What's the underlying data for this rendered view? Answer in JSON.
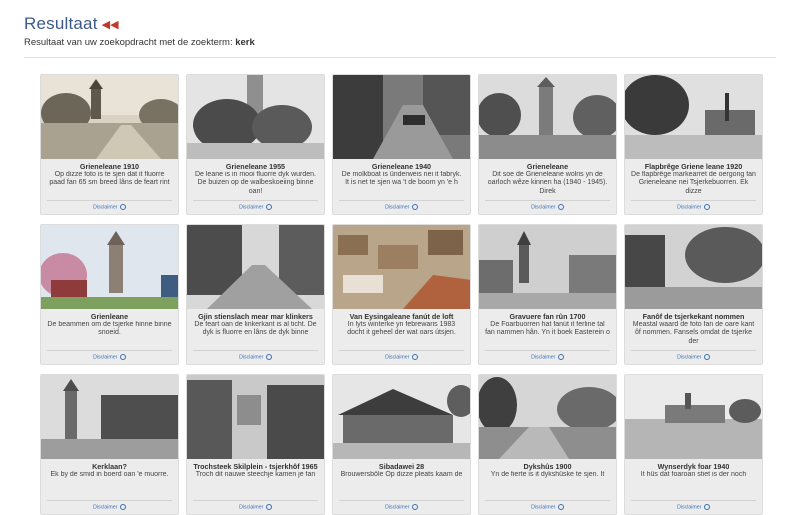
{
  "header": {
    "title": "Resultaat",
    "subtitle_prefix": "Resultaat van uw zoekopdracht met de zoekterm:",
    "search_term": "kerk"
  },
  "cards": [
    {
      "title": "Grieneleane 1910",
      "description": "Op dizze foto is te sjen dat it fluorre paad fan 65 sm breed lâns de feart rint",
      "disclaimer": "Disclaimer"
    },
    {
      "title": "Grieneleane 1955",
      "description": "De leane is in mooi fluorre dyk wurden. De buizen op de walbeskoeiing binne oan!",
      "disclaimer": "Disclaimer"
    },
    {
      "title": "Grieneleane 1940",
      "description": "De molkboat is ûnderweis nei it fabryk. It is net te sjen wa 't de boom yn 'e h",
      "disclaimer": "Disclaimer"
    },
    {
      "title": "Grieneleane",
      "description": "Dit soe de Grieneleane wolris yn de oarloch wêze kinnen ha (1940 - 1945). Direk",
      "disclaimer": "Disclaimer"
    },
    {
      "title": "Flapbrêge Griene leane 1920",
      "description": "De flapbrêge markearret de oergong fan Grieneleane nei Tsjerkebuorren. Ek dizze",
      "disclaimer": "Disclaimer"
    },
    {
      "title": "Grienleane",
      "description": "De beammen om de tsjerke hinne binne snoeid.",
      "disclaimer": "Disclaimer"
    },
    {
      "title": "Gjin stienslach mear mar klinkers",
      "description": "De feart oan de linkerkant is al ticht. De dyk is fluorre en lâns de dyk binne",
      "disclaimer": "Disclaimer"
    },
    {
      "title": "Van Eysingaleane fanút de loft",
      "description": "In lyts winterke yn febrewaris 1983 docht it geheel der wat oars útsjen.",
      "disclaimer": "Disclaimer"
    },
    {
      "title": "Gravuere fan rûn 1700",
      "description": "De Foarbuorren hat fanút it ferline tal fan nammen hân. Yn it boek Easterein o",
      "disclaimer": "Disclaimer"
    },
    {
      "title": "Fanôf de tsjerkekant nommen",
      "description": "Meastal waard de foto fan de oare kant ôf nommen. Fansels omdat de tsjerke der",
      "disclaimer": "Disclaimer"
    },
    {
      "title": "Kerklaan?",
      "description": "Ek by de smid in boerd oan 'e muorre.",
      "disclaimer": "Disclaimer"
    },
    {
      "title": "Trochsteek Skilplein - tsjerkhôf 1965",
      "description": "Troch dit nauwe steechje kamen je fan",
      "disclaimer": "Disclaimer"
    },
    {
      "title": "Sibadawei 28",
      "description": "Brouwersbôle Op dizze pleats kaam de",
      "disclaimer": "Disclaimer"
    },
    {
      "title": "Dykshûs 1900",
      "description": "Yn de fierte is it dykshûske te sjen. It",
      "disclaimer": "Disclaimer"
    },
    {
      "title": "Wynserdyk foar 1940",
      "description": "It hûs dat foaroan stiet is der noch",
      "disclaimer": "Disclaimer"
    }
  ],
  "colors": {
    "title": "#3d5a8c",
    "accent_icon": "#c0392b",
    "link": "#3d6fb3",
    "card_bg": "#ececec"
  },
  "icons": {
    "back": "double-chevron-left-icon",
    "info": "info-circle-icon"
  }
}
